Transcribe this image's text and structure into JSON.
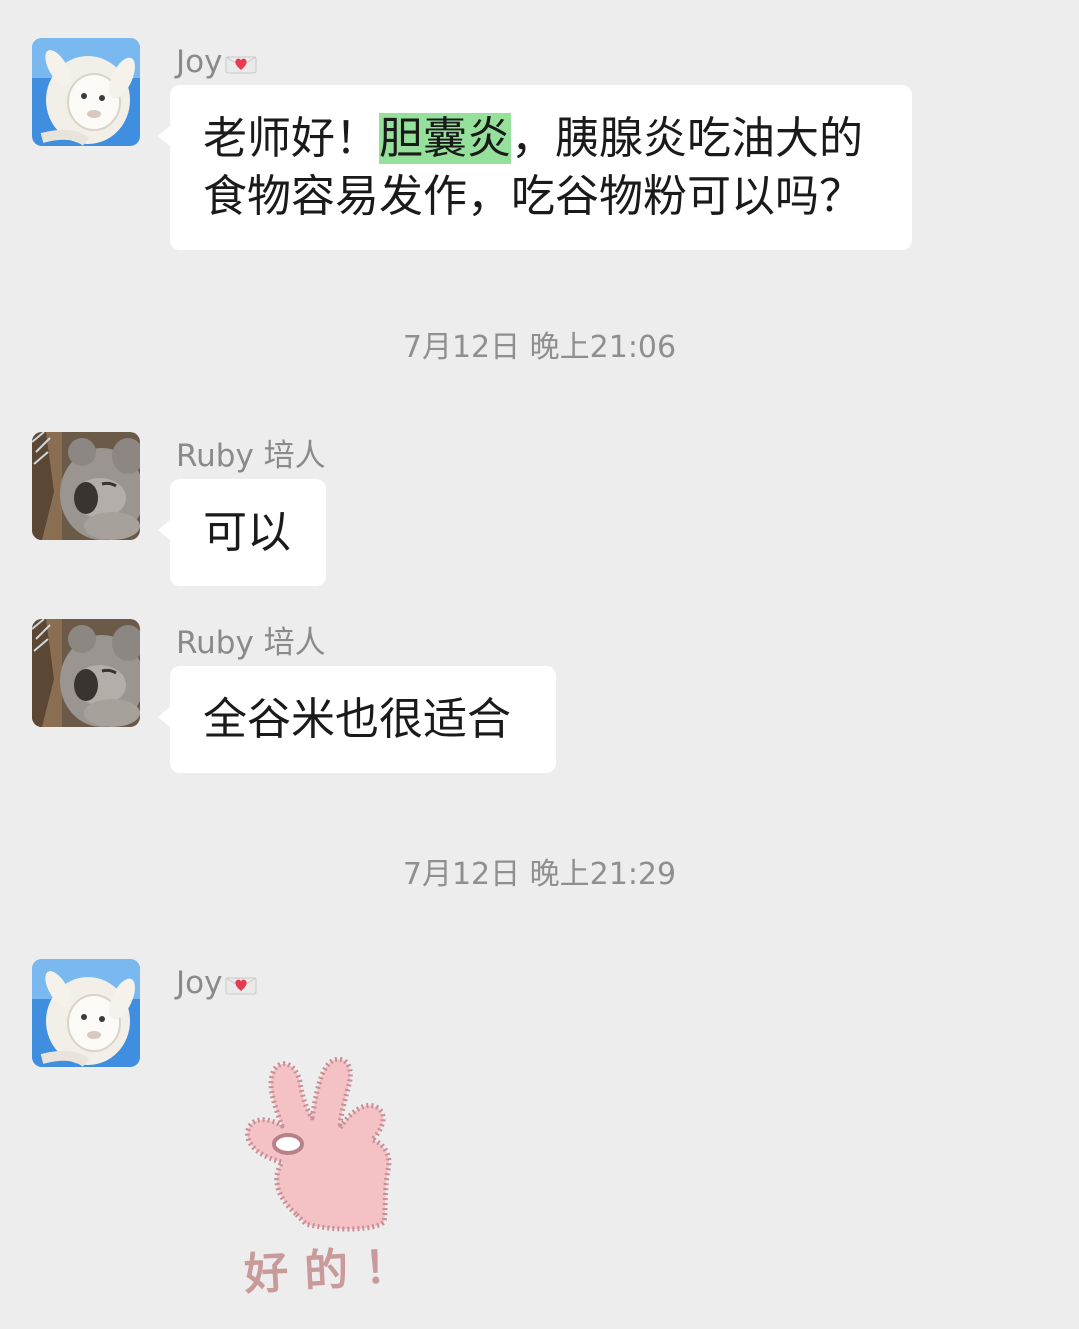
{
  "messages": [
    {
      "sender": "Joy",
      "text_before": "老师好！",
      "highlight": "胆囊炎",
      "text_after": "，胰腺炎吃油大的食物容易发作，吃谷物粉可以吗？"
    },
    {
      "timestamp": "7月12日 晚上21:06"
    },
    {
      "sender": "Ruby 培人",
      "text": "可以"
    },
    {
      "sender": "Ruby 培人",
      "text": "全谷米也很适合"
    },
    {
      "timestamp": "7月12日 晚上21:29"
    },
    {
      "sender": "Joy",
      "sticker_text": "好的！",
      "sticker_icon": "ok-hand-sticker"
    }
  ],
  "colors": {
    "background": "#ededed",
    "bubble": "#ffffff",
    "highlight": "#95e09a",
    "sender_name": "#8a8a8a",
    "timestamp": "#8f8f8f",
    "sticker_hand": "#f4c2c4",
    "sticker_text": "#c99a9a"
  }
}
